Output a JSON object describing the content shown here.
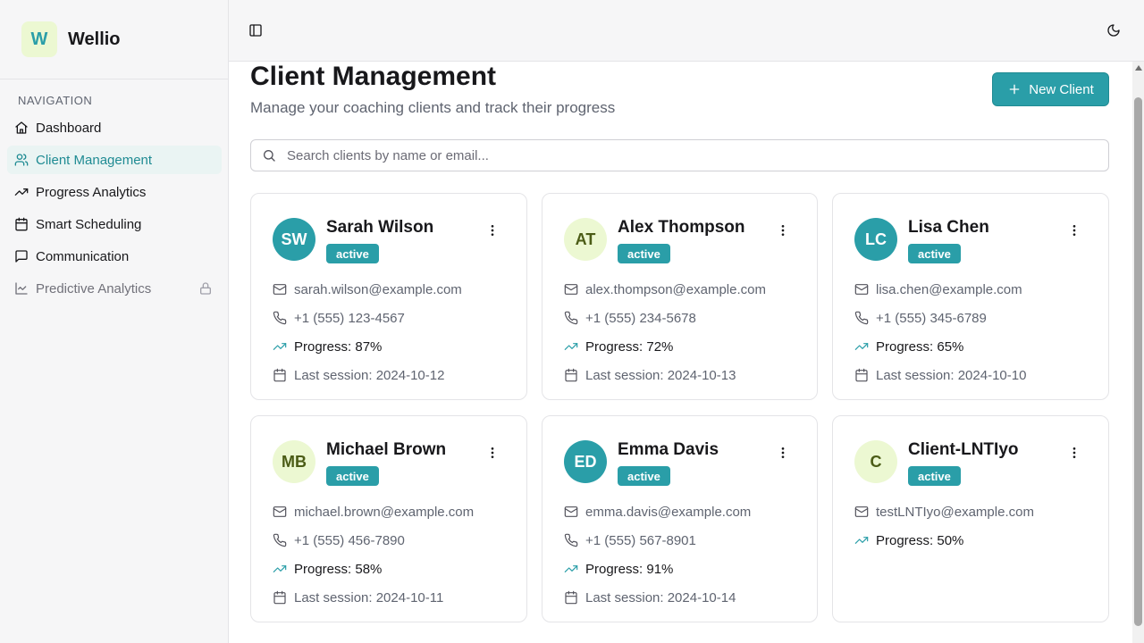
{
  "app": {
    "logo_letter": "W",
    "name": "Wellio"
  },
  "sidebar": {
    "heading": "NAVIGATION",
    "items": [
      {
        "label": "Dashboard",
        "icon": "home-icon"
      },
      {
        "label": "Client Management",
        "icon": "users-icon",
        "active": true
      },
      {
        "label": "Progress Analytics",
        "icon": "trending-up-icon"
      },
      {
        "label": "Smart Scheduling",
        "icon": "calendar-icon"
      },
      {
        "label": "Communication",
        "icon": "message-icon"
      },
      {
        "label": "Predictive Analytics",
        "icon": "line-chart-icon",
        "locked": true
      }
    ]
  },
  "header": {
    "sidebar_toggle": "panel-left-icon",
    "theme_toggle": "moon-icon"
  },
  "page": {
    "title": "Client Management",
    "subtitle": "Manage your coaching clients and track their progress",
    "new_button": "New Client",
    "search_placeholder": "Search clients by name or email..."
  },
  "clients": [
    {
      "initials": "SW",
      "name": "Sarah Wilson",
      "status": "active",
      "email": "sarah.wilson@example.com",
      "phone": "+1 (555) 123-4567",
      "progress": "Progress: 87%",
      "last_session": "Last session: 2024-10-12",
      "avatar_color": "#2a9ea8"
    },
    {
      "initials": "AT",
      "name": "Alex Thompson",
      "status": "active",
      "email": "alex.thompson@example.com",
      "phone": "+1 (555) 234-5678",
      "progress": "Progress: 72%",
      "last_session": "Last session: 2024-10-13",
      "avatar_color": "#ecf8d2"
    },
    {
      "initials": "LC",
      "name": "Lisa Chen",
      "status": "active",
      "email": "lisa.chen@example.com",
      "phone": "+1 (555) 345-6789",
      "progress": "Progress: 65%",
      "last_session": "Last session: 2024-10-10",
      "avatar_color": "#2a9ea8"
    },
    {
      "initials": "MB",
      "name": "Michael Brown",
      "status": "active",
      "email": "michael.brown@example.com",
      "phone": "+1 (555) 456-7890",
      "progress": "Progress: 58%",
      "last_session": "Last session: 2024-10-11",
      "avatar_color": "#ecf8d2"
    },
    {
      "initials": "ED",
      "name": "Emma Davis",
      "status": "active",
      "email": "emma.davis@example.com",
      "phone": "+1 (555) 567-8901",
      "progress": "Progress: 91%",
      "last_session": "Last session: 2024-10-14",
      "avatar_color": "#2a9ea8"
    },
    {
      "initials": "C",
      "name": "Client-LNTIyo",
      "status": "active",
      "email": "testLNTIyo@example.com",
      "progress": "Progress: 50%",
      "avatar_color": "#ecf8d2"
    }
  ],
  "colors": {
    "accent": "#2a9ea8",
    "accent_light": "#ecf8d2",
    "active_nav_bg": "#eaf4f3"
  }
}
